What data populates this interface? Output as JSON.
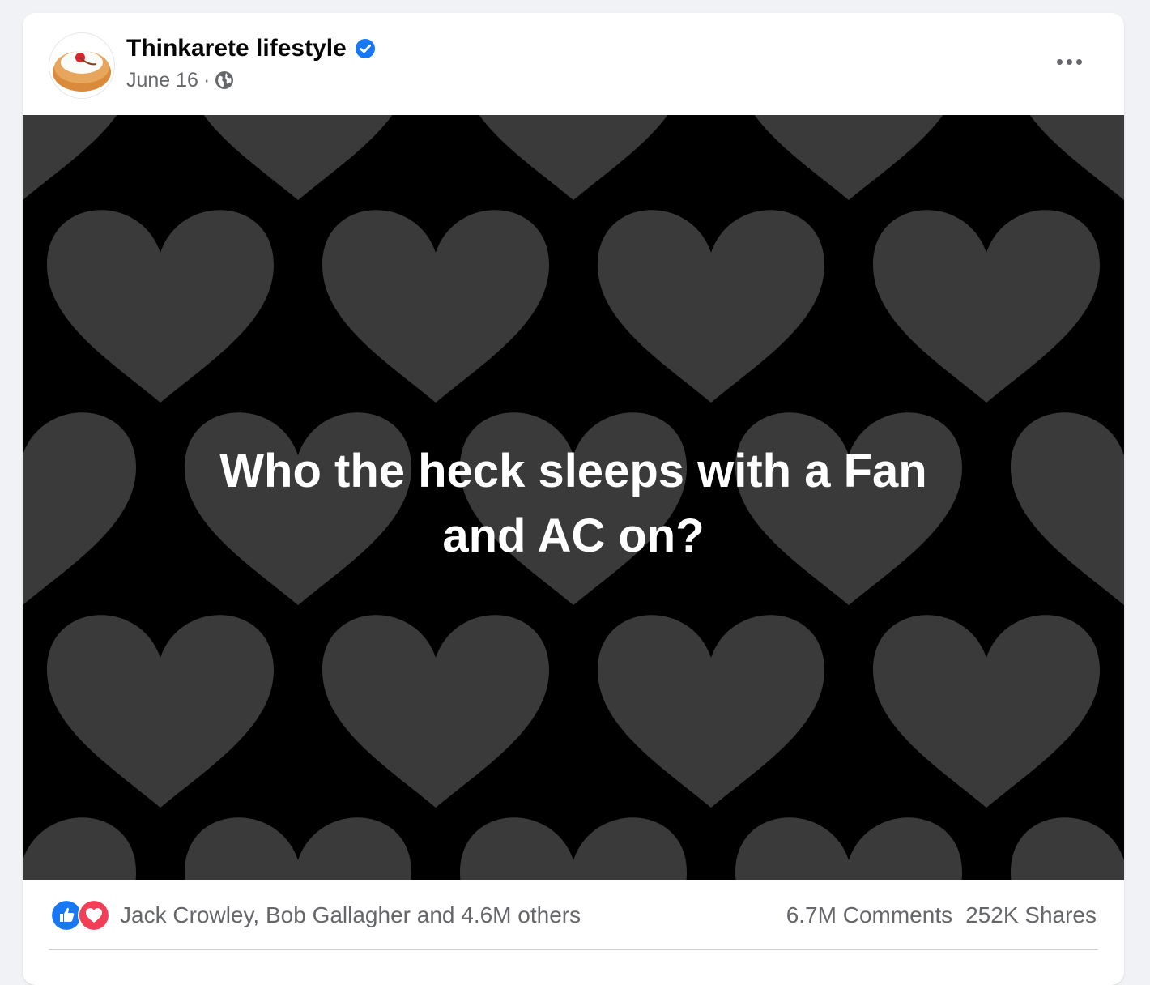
{
  "post": {
    "page_name": "Thinkarete lifestyle",
    "date": "June 16",
    "separator": "·",
    "audience_icon": "globe-icon",
    "verified_icon": "verified-badge-icon",
    "more_icon": "more-options-icon",
    "text": "Who the heck sleeps with a Fan and AC on?",
    "background": "dark-grey-hearts-on-black"
  },
  "footer": {
    "reaction_icons": [
      "like-icon",
      "love-icon"
    ],
    "reactors": "Jack Crowley, Bob Gallagher and 4.6M others",
    "comments": "6.7M Comments",
    "shares": "252K Shares"
  },
  "colors": {
    "verified_blue": "#1877f2",
    "like_blue": "#1877f2",
    "love_red": "#f33e58",
    "secondary_text": "#65676b",
    "heart_fill": "#3a3a3a"
  }
}
